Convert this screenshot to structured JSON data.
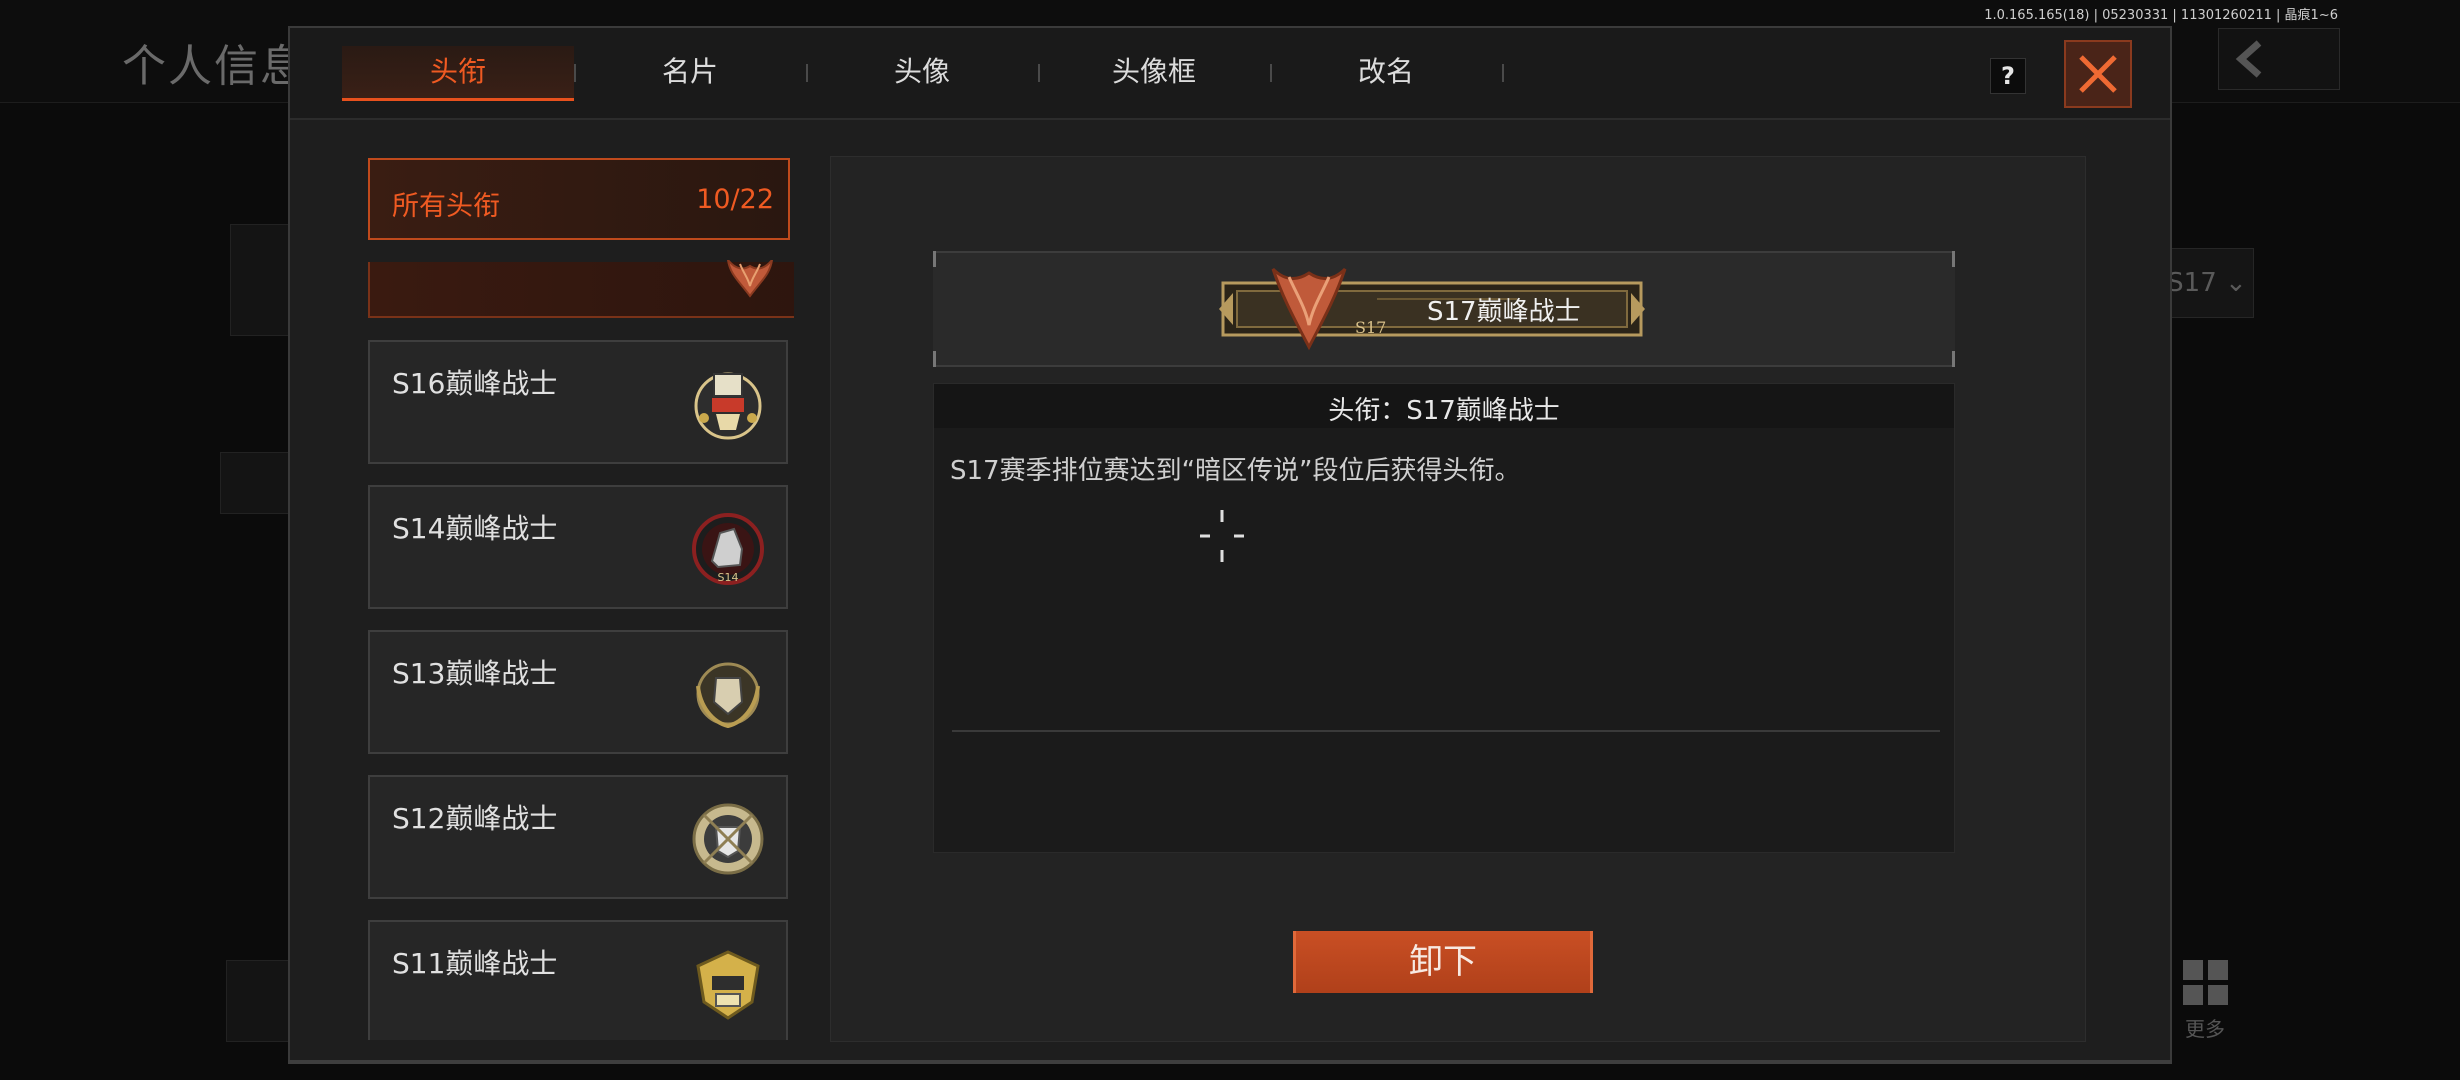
{
  "version_text": "1.0.165.165(18) | 05230331 | 11301260211 | 晶痕1~6",
  "background": {
    "page_title": "个人信息",
    "season_select": "S17",
    "more_label": "更多"
  },
  "tabs": [
    {
      "label": "头衔",
      "active": true
    },
    {
      "label": "名片",
      "active": false
    },
    {
      "label": "头像",
      "active": false
    },
    {
      "label": "头像框",
      "active": false
    },
    {
      "label": "改名",
      "active": false
    }
  ],
  "help_label": "?",
  "list": {
    "header_label": "所有头衔",
    "header_count": "10/22",
    "items": [
      {
        "name": "S16巅峰战士",
        "icon": "s16-badge-icon"
      },
      {
        "name": "S14巅峰战士",
        "icon": "s14-badge-icon"
      },
      {
        "name": "S13巅峰战士",
        "icon": "s13-badge-icon"
      },
      {
        "name": "S12巅峰战士",
        "icon": "s12-badge-icon"
      },
      {
        "name": "S11巅峰战士",
        "icon": "s11-badge-icon"
      }
    ]
  },
  "detail": {
    "nameplate_season": "S17",
    "nameplate_label": "S17巅峰战士",
    "title_line": "头衔：S17巅峰战士",
    "description": "S17赛季排位赛达到“暗区传说”段位后获得头衔。",
    "action_label": "卸下"
  },
  "colors": {
    "accent": "#e8511d",
    "panel": "#1e1e1e",
    "text": "#dcdcdc"
  }
}
